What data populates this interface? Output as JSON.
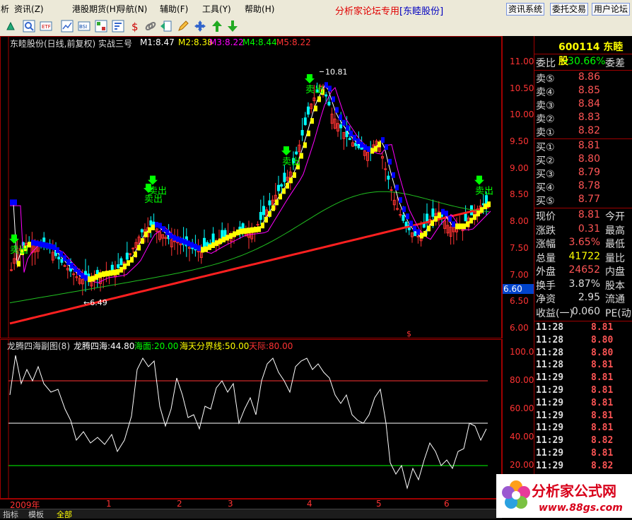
{
  "menu": {
    "items": [
      "析",
      "资讯",
      "港股期货",
      "导航",
      "辅助",
      "工具",
      "帮助"
    ],
    "shortcuts": [
      "(Z)",
      "(H)",
      "(N)",
      "(F)",
      "(Y)",
      "(H)"
    ],
    "forum_title": "分析家论坛专用",
    "stock_tag": "[东睦股份]",
    "buttons": [
      "资讯系统",
      "委托交易",
      "用户论坛"
    ]
  },
  "main_chart": {
    "title": "东睦股份(日线,前复权) 实战三号",
    "ma_labels": [
      {
        "text": "M1:8.47",
        "color": "#ffffff"
      },
      {
        "text": "M2:8.38",
        "color": "#ffff00"
      },
      {
        "text": "M3:8.22",
        "color": "#ff00ff"
      },
      {
        "text": "M4:8.44",
        "color": "#00ff00"
      },
      {
        "text": "M5:8.22",
        "color": "#ff3333"
      }
    ],
    "y_ticks": [
      "11.00",
      "10.50",
      "10.00",
      "9.50",
      "9.00",
      "8.50",
      "8.00",
      "7.50",
      "7.00",
      "6.50",
      "6.00"
    ],
    "current_price_tag": "6.60",
    "high_label": "10.81",
    "low_label": "6.49",
    "sell_label": "卖出",
    "s_mark": "$"
  },
  "sub_chart": {
    "title": "龙腾四海副图(8)",
    "ind": {
      "text": "龙腾四海:44.80",
      "color": "#ffffff"
    },
    "sea": {
      "text": "海面:20.00",
      "color": "#00ff00"
    },
    "divide": {
      "text": "海天分界线:50.00",
      "color": "#ffff00"
    },
    "sky": {
      "text": "天际:80.00",
      "color": "#ff3333"
    },
    "y_ticks": [
      "100.0",
      "80.00",
      "60.00",
      "40.00",
      "20.00"
    ]
  },
  "x_axis": {
    "year": "2009年",
    "months": [
      "1",
      "2",
      "3",
      "4",
      "5",
      "6"
    ]
  },
  "bottom_tabs": [
    "指标",
    "模板",
    "全部"
  ],
  "panel": {
    "code": "600114",
    "name": "东睦股",
    "weibi": {
      "label": "委比",
      "value": "-30.66%",
      "right": "委差"
    },
    "asks": [
      {
        "label": "卖⑤",
        "price": "8.86"
      },
      {
        "label": "卖④",
        "price": "8.85"
      },
      {
        "label": "卖③",
        "price": "8.84"
      },
      {
        "label": "卖②",
        "price": "8.83"
      },
      {
        "label": "卖①",
        "price": "8.82"
      }
    ],
    "bids": [
      {
        "label": "买①",
        "price": "8.81"
      },
      {
        "label": "买②",
        "price": "8.80"
      },
      {
        "label": "买③",
        "price": "8.79"
      },
      {
        "label": "买④",
        "price": "8.78"
      },
      {
        "label": "买⑤",
        "price": "8.77"
      }
    ],
    "stats": [
      {
        "label": "现价",
        "value": "8.81",
        "color": "#ff5555",
        "right": "今开"
      },
      {
        "label": "涨跌",
        "value": "0.31",
        "color": "#ff5555",
        "right": "最高"
      },
      {
        "label": "涨幅",
        "value": "3.65%",
        "color": "#ff5555",
        "right": "最低"
      },
      {
        "label": "总量",
        "value": "41722",
        "color": "#ffff00",
        "right": "量比"
      },
      {
        "label": "外盘",
        "value": "24652",
        "color": "#ff5555",
        "right": "内盘"
      },
      {
        "label": "换手",
        "value": "3.87%",
        "color": "#dddddd",
        "right": "股本"
      },
      {
        "label": "净资",
        "value": "2.95",
        "color": "#dddddd",
        "right": "流通"
      },
      {
        "label": "收益(一)",
        "value": "0.060",
        "color": "#dddddd",
        "right": "PE(动"
      }
    ],
    "ticks": [
      {
        "time": "11:28",
        "price": "8.81"
      },
      {
        "time": "11:28",
        "price": "8.80"
      },
      {
        "time": "11:28",
        "price": "8.80"
      },
      {
        "time": "11:28",
        "price": "8.81"
      },
      {
        "time": "11:29",
        "price": "8.81"
      },
      {
        "time": "11:29",
        "price": "8.81"
      },
      {
        "time": "11:29",
        "price": "8.81"
      },
      {
        "time": "11:29",
        "price": "8.81"
      },
      {
        "time": "11:29",
        "price": "8.81"
      },
      {
        "time": "11:29",
        "price": "8.82"
      },
      {
        "time": "11:29",
        "price": "8.81"
      },
      {
        "time": "11:29",
        "price": "8.82"
      },
      {
        "time": "11:29",
        "price": "8.81"
      }
    ]
  },
  "logo": {
    "brand": "分析家公式网",
    "url": "www.88gs.com"
  },
  "colors": {
    "frame": "#a00000",
    "up": "#ff3333",
    "down": "#00ffff",
    "accent": "#ff5555"
  }
}
